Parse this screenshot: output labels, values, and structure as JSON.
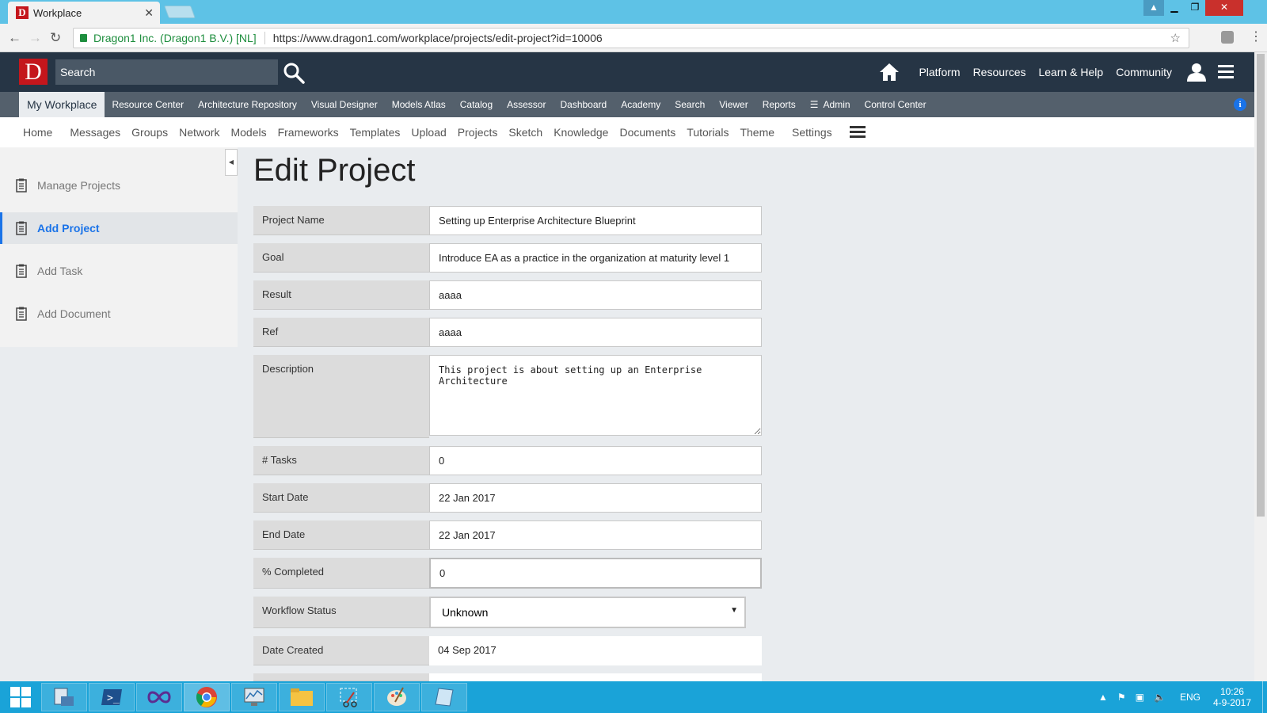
{
  "browser": {
    "tab_title": "Workplace",
    "favicon_letter": "D",
    "address_secure_label": "Dragon1 Inc. (Dragon1 B.V.) [NL]",
    "address_url": "https://www.dragon1.com/workplace/projects/edit-project?id=10006"
  },
  "header": {
    "logo_letter": "D",
    "search_placeholder": "Search",
    "links": [
      "Platform",
      "Resources",
      "Learn & Help",
      "Community"
    ]
  },
  "subnav": {
    "items": [
      "My Workplace",
      "Resource Center",
      "Architecture Repository",
      "Visual Designer",
      "Models Atlas",
      "Catalog",
      "Assessor",
      "Dashboard",
      "Academy",
      "Search",
      "Viewer",
      "Reports",
      "Admin",
      "Control Center"
    ],
    "info": "i"
  },
  "thirdnav": {
    "items": [
      "Home",
      "Messages",
      "Groups",
      "Network",
      "Models",
      "Frameworks",
      "Templates",
      "Upload",
      "Projects",
      "Sketch",
      "Knowledge",
      "Documents",
      "Tutorials",
      "Theme",
      "Settings"
    ]
  },
  "sidebar": {
    "items": [
      {
        "label": "Manage Projects",
        "icon": "clipboard-icon"
      },
      {
        "label": "Add Project",
        "icon": "clipboard-icon"
      },
      {
        "label": "Add Task",
        "icon": "clipboard-icon"
      },
      {
        "label": "Add Document",
        "icon": "clipboard-icon"
      }
    ]
  },
  "form": {
    "title": "Edit Project",
    "project_name_label": "Project Name",
    "project_name": "Setting up Enterprise Architecture Blueprint",
    "goal_label": "Goal",
    "goal": "Introduce EA as a practice in the organization at maturity level 1",
    "result_label": "Result",
    "result": "aaaa",
    "ref_label": "Ref",
    "ref": "aaaa",
    "description_label": "Description",
    "description": "This project is about setting up an Enterprise Architecture",
    "tasks_label": "# Tasks",
    "tasks": "0",
    "start_date_label": "Start Date",
    "start_date": "22 Jan 2017",
    "end_date_label": "End Date",
    "end_date": "22 Jan 2017",
    "completed_label": "% Completed",
    "completed": "0",
    "workflow_label": "Workflow Status",
    "workflow_status": "Unknown",
    "date_created_label": "Date Created",
    "date_created": "04 Sep 2017"
  },
  "taskbar": {
    "language": "ENG",
    "time": "10:26",
    "date": "4-9-2017"
  },
  "colors": {
    "header_bg": "#263545",
    "subnav_bg": "#54606c",
    "accent": "#1a73e8",
    "logo_red": "#c4161c",
    "taskbar": "#1aa3d8"
  }
}
